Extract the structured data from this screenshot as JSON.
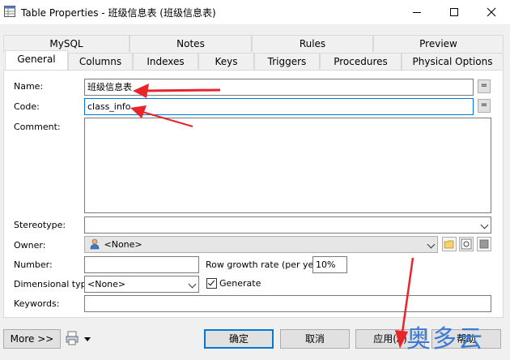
{
  "window": {
    "title": "Table Properties - 班级信息表 (班级信息表)"
  },
  "tabs_row1": [
    "MySQL",
    "Notes",
    "Rules",
    "Preview"
  ],
  "tabs_row2": [
    "General",
    "Columns",
    "Indexes",
    "Keys",
    "Triggers",
    "Procedures",
    "Physical Options"
  ],
  "active_tab": "General",
  "form": {
    "name_label": "Name:",
    "name_value": "班级信息表",
    "code_label": "Code:",
    "code_value": "class_info",
    "equals_btn": "=",
    "comment_label": "Comment:",
    "comment_value": "",
    "stereotype_label": "Stereotype:",
    "stereotype_value": "",
    "owner_label": "Owner:",
    "owner_value": "<None>",
    "number_label": "Number:",
    "number_value": "",
    "row_growth_label": "Row growth rate (per year):",
    "row_growth_value": "10%",
    "dimensional_label": "Dimensional type:",
    "dimensional_value": "<None>",
    "generate_label": "Generate",
    "generate_checked": true,
    "keywords_label": "Keywords:",
    "keywords_value": ""
  },
  "buttons": {
    "more": "More >>",
    "ok": "确定",
    "cancel": "取消",
    "apply": "应用(A)",
    "help": "帮助"
  },
  "watermark": "奥多云",
  "colors": {
    "focus_border": "#0078d7",
    "annotation_arrow": "#e8252b",
    "watermark": "#3a7ad5"
  }
}
